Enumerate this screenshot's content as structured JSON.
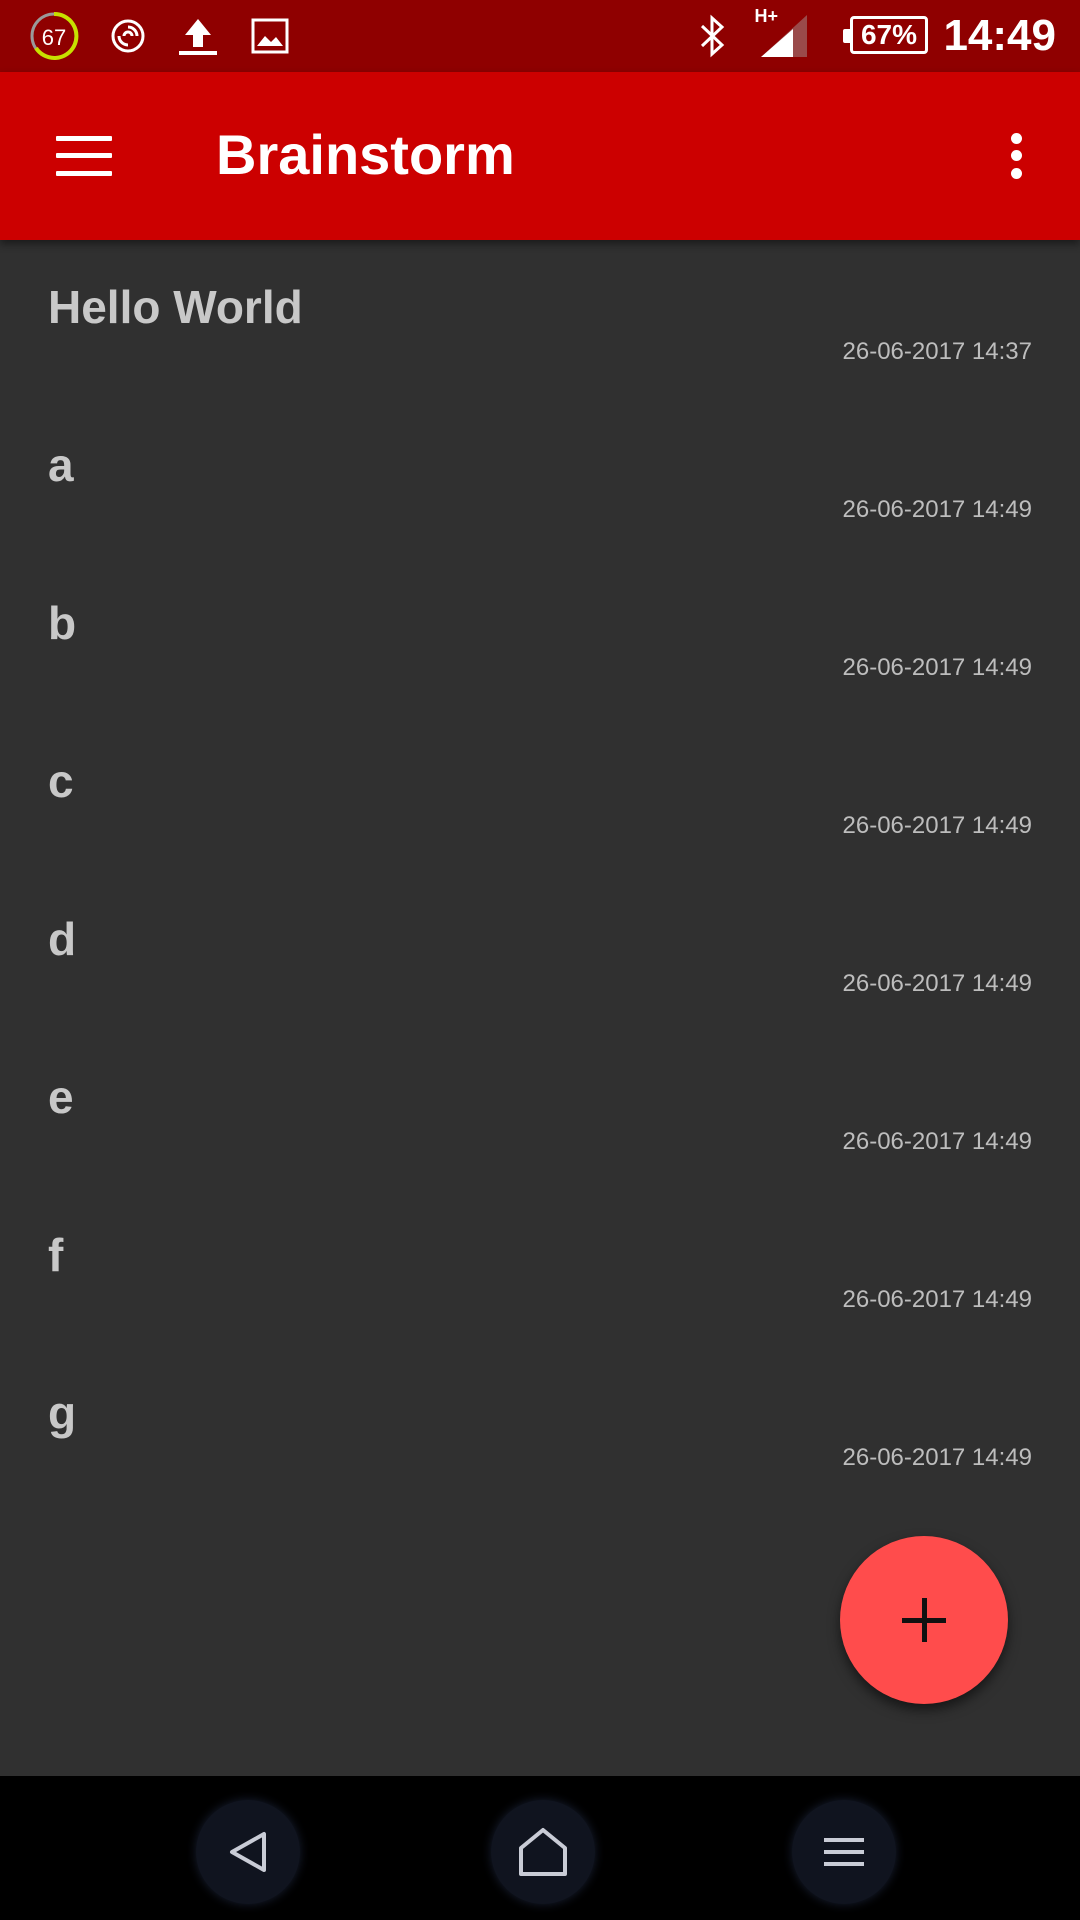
{
  "status_bar": {
    "notification_badge": "67",
    "hplus_label": "H+",
    "battery": "67%",
    "time": "14:49"
  },
  "app_bar": {
    "title": "Brainstorm"
  },
  "notes": [
    {
      "title": "Hello World",
      "date": "26-06-2017 14:37"
    },
    {
      "title": "a",
      "date": "26-06-2017 14:49"
    },
    {
      "title": "b",
      "date": "26-06-2017 14:49"
    },
    {
      "title": "c",
      "date": "26-06-2017 14:49"
    },
    {
      "title": "d",
      "date": "26-06-2017 14:49"
    },
    {
      "title": "e",
      "date": "26-06-2017 14:49"
    },
    {
      "title": "f",
      "date": "26-06-2017 14:49"
    },
    {
      "title": "g",
      "date": "26-06-2017 14:49"
    }
  ],
  "colors": {
    "status_bar": "#8f0000",
    "app_bar": "#cc0000",
    "background": "#303030",
    "fab": "#ff4c4c"
  },
  "icons": {
    "status_left": [
      "counter-badge-icon",
      "spiral-app-icon",
      "upload-icon",
      "image-icon"
    ],
    "status_right": [
      "bluetooth-icon",
      "signal-icon",
      "battery-icon"
    ],
    "app_bar": [
      "hamburger-menu-icon",
      "overflow-menu-icon"
    ],
    "fab": "add-icon",
    "nav": [
      "back-icon",
      "home-icon",
      "recent-apps-icon"
    ]
  }
}
